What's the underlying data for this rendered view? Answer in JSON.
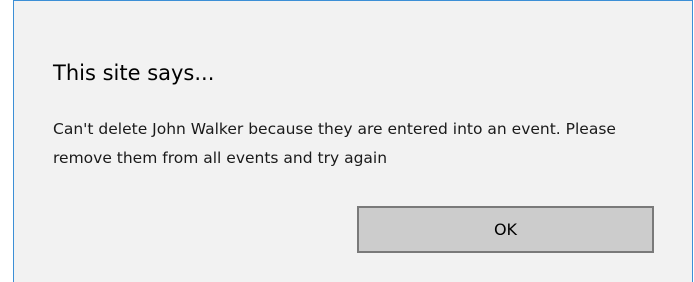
{
  "dialog": {
    "title": "This site says...",
    "message": "Can't delete John Walker because they are entered into an event. Please remove them from all events and try again",
    "ok_label": "OK"
  },
  "colors": {
    "dialog_background": "#f2f2f2",
    "border_accent": "#3c8fd6",
    "button_background": "#cccccc",
    "button_border": "#7a7a7a"
  }
}
